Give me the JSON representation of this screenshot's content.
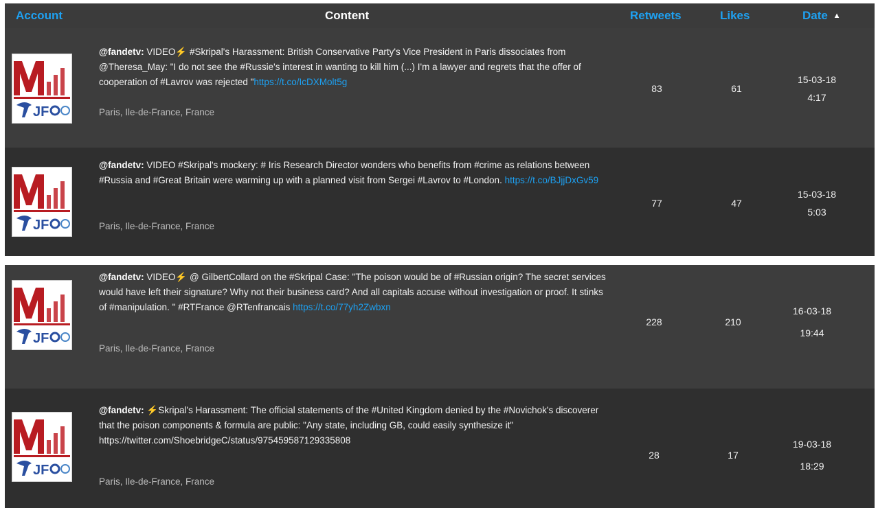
{
  "header": {
    "account": "Account",
    "content": "Content",
    "retweets": "Retweets",
    "likes": "Likes",
    "date": "Date",
    "sort_icon": "sort-ascending-icon",
    "accent_color": "#1ea1f2"
  },
  "rows": [
    {
      "user": "@fandetv:",
      "text": " VIDEO⚡ #Skripal's Harassment: British Conservative Party's Vice President in Paris dissociates from @Theresa_May: \"I do not see the #Russie's interest in wanting to kill him (...) I'm a lawyer and regrets that the offer of cooperation of #Lavrov was rejected \"",
      "link": "https://t.co/IcDXMolt5g",
      "location": "Paris, Ile-de-France, France",
      "retweets": "83",
      "likes": "61",
      "date": "15-03-18",
      "time": "4:17"
    },
    {
      "user": "@fandetv:",
      "text": " VIDEO #Skripal's mockery: # Iris Research Director wonders who benefits from #crime as relations between #Russia and #Great Britain were warming up with a planned visit from Sergei #Lavrov to #London. ",
      "link": "https://t.co/BJjjDxGv59",
      "location": "Paris, Ile-de-France, France",
      "retweets": "77",
      "likes": "47",
      "date": "15-03-18",
      "time": "5:03"
    },
    {
      "user": "@fandetv:",
      "text": " VIDEO⚡ @ GilbertCollard on the #Skripal Case: \"The poison would be of #Russian origin? The secret services would have left their signature? Why not their business card? And all capitals accuse without investigation or proof. It stinks of #manipulation. \" #RTFrance @RTenfrancais ",
      "link": "https://t.co/77yh2Zwbxn",
      "location": "Paris, Ile-de-France, France",
      "retweets": "228",
      "likes": "210",
      "date": "16-03-18",
      "time": "19:44"
    },
    {
      "user": "@fandetv:",
      "text": " ⚡Skripal's Harassment: The official statements of the #United Kingdom denied by the #Novichok's discoverer that the poison components & formula are public: \"Any state, including GB, could easily synthesize it\" https://twitter.com/ShoebridgeC/status/975459587129335808",
      "link": "",
      "location": "Paris, Ile-de-France, France",
      "retweets": "28",
      "likes": "17",
      "date": "19-03-18",
      "time": "18:29"
    }
  ],
  "logo": {
    "icon": "fandetv-logo-icon",
    "brand_red": "#b81c22",
    "brand_blue": "#2a4fa0"
  }
}
